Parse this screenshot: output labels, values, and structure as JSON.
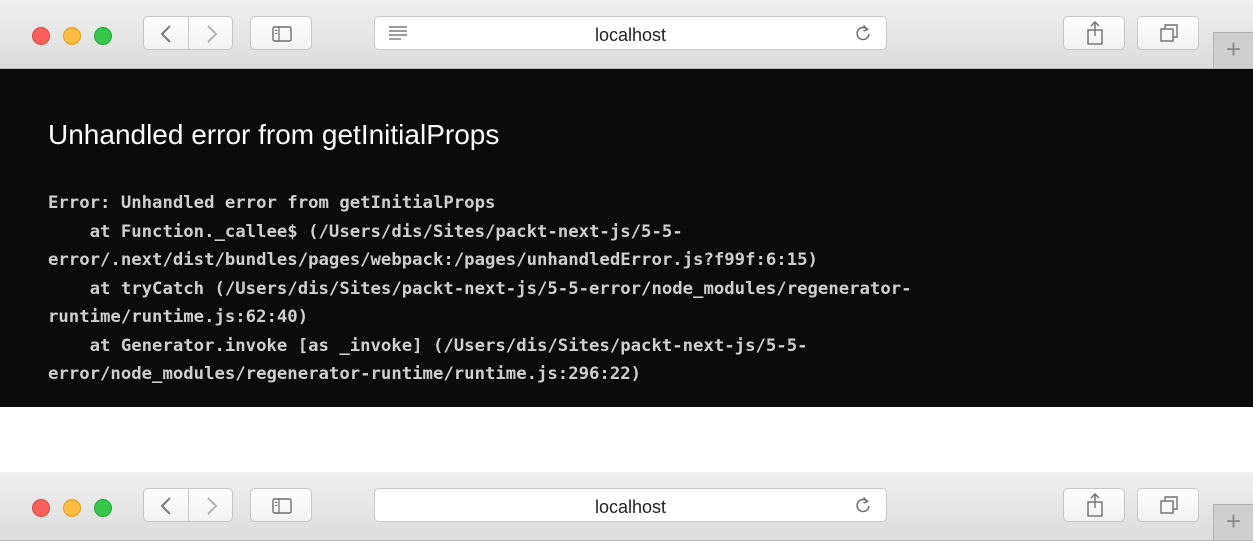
{
  "windows": [
    {
      "address": {
        "url": "localhost"
      },
      "content": {
        "error_title": "Unhandled error from getInitialProps",
        "stack_lines": [
          "Error: Unhandled error from getInitialProps",
          "    at Function._callee$ (/Users/dis/Sites/packt-next-js/5-5-",
          "error/.next/dist/bundles/pages/webpack:/pages/unhandledError.js?f99f:6:15)",
          "    at tryCatch (/Users/dis/Sites/packt-next-js/5-5-error/node_modules/regenerator-",
          "runtime/runtime.js:62:40)",
          "    at Generator.invoke [as _invoke] (/Users/dis/Sites/packt-next-js/5-5-",
          "error/node_modules/regenerator-runtime/runtime.js:296:22)"
        ]
      }
    },
    {
      "address": {
        "url": "localhost"
      }
    }
  ],
  "icons": {
    "close": "red-dot",
    "minimize": "yellow-dot",
    "zoom": "green-dot",
    "back": "chevron-left-icon",
    "forward": "chevron-right-icon",
    "sidebar": "sidebar-icon",
    "reader": "reader-icon",
    "reload": "reload-icon",
    "share": "share-icon",
    "tabs": "tabs-icon",
    "new_tab": "plus-icon"
  },
  "colors": {
    "content_bg": "#0b0b0b",
    "title": "#ffffff",
    "stack_text": "#cfcfcf"
  }
}
